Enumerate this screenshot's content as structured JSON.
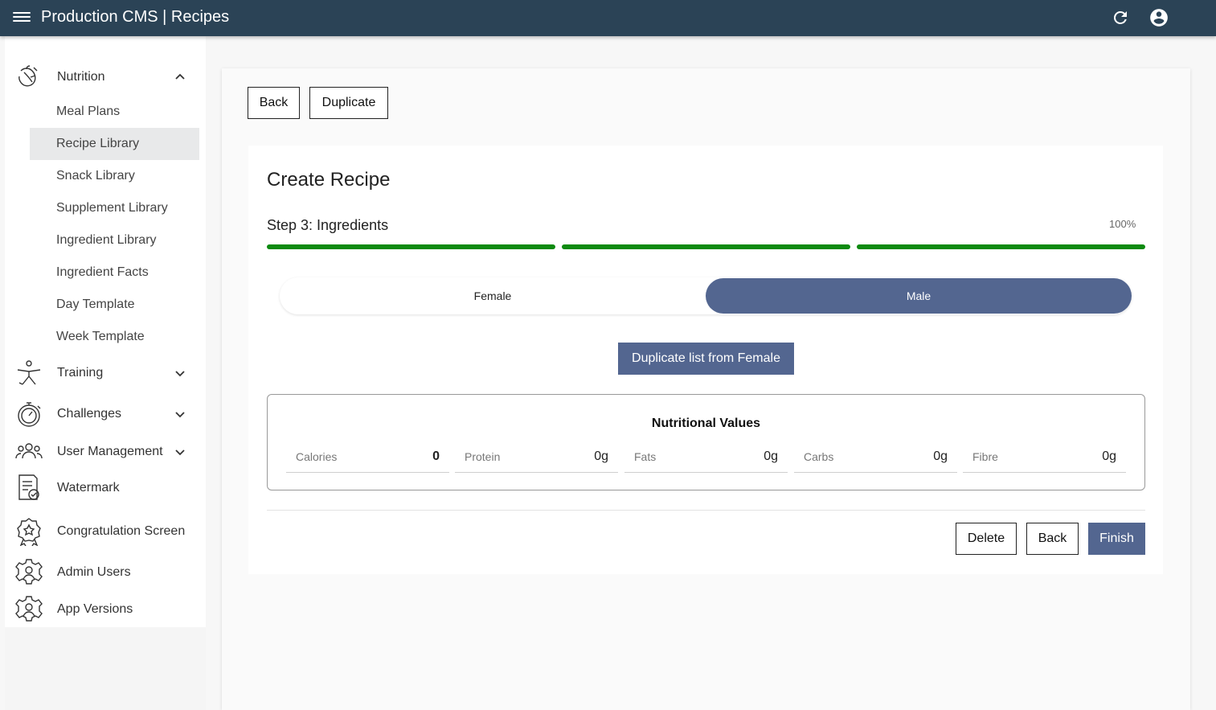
{
  "header": {
    "title": "Production CMS | Recipes"
  },
  "sidebar": {
    "nutrition": {
      "label": "Nutrition",
      "items": [
        "Meal Plans",
        "Recipe Library",
        "Snack Library",
        "Supplement Library",
        "Ingredient Library",
        "Ingredient Facts",
        "Day Template",
        "Week Template"
      ],
      "active_index": 1
    },
    "groups": [
      "Training",
      "Challenges",
      "User Management",
      "Watermark",
      "Congratulation Screen",
      "Admin Users",
      "App Versions"
    ]
  },
  "toolbar": {
    "back": "Back",
    "duplicate": "Duplicate"
  },
  "form": {
    "title": "Create Recipe",
    "step": "Step 3: Ingredients",
    "percent": "100%",
    "progress_fraction": 1.0,
    "gender_options": [
      "Female",
      "Male"
    ],
    "selected_gender": "Male",
    "duplicate_list_label": "Duplicate list from Female",
    "nutrition": {
      "title": "Nutritional Values",
      "fields": [
        {
          "label": "Calories",
          "value": "0"
        },
        {
          "label": "Protein",
          "value": "0g"
        },
        {
          "label": "Fats",
          "value": "0g"
        },
        {
          "label": "Carbs",
          "value": "0g"
        },
        {
          "label": "Fibre",
          "value": "0g"
        }
      ]
    },
    "actions": {
      "delete": "Delete",
      "back": "Back",
      "finish": "Finish"
    }
  },
  "colors": {
    "topbar": "#2b4356",
    "accent": "#536690",
    "progress": "#0d8a10"
  }
}
